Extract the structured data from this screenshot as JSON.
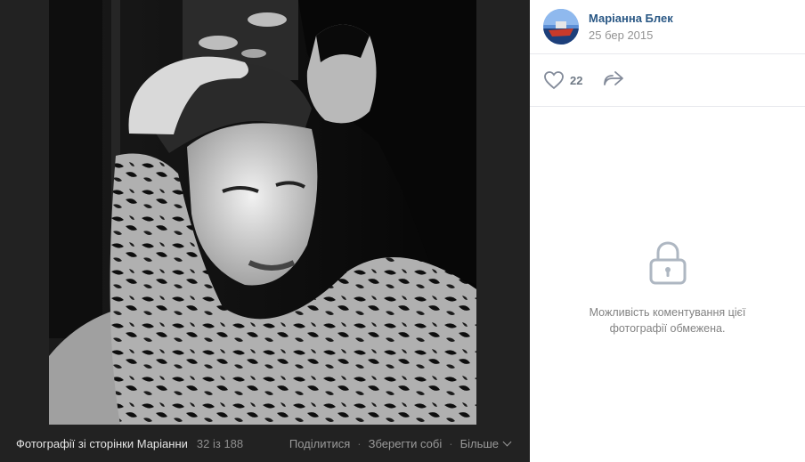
{
  "author": {
    "name": "Маріанна Блек",
    "date": "25 бер 2015"
  },
  "likes": {
    "count": "22"
  },
  "comments": {
    "restricted_line1": "Можливість коментування цієї",
    "restricted_line2": "фотографії обмежена."
  },
  "bottom_bar": {
    "album_title": "Фотографії зі сторінки Маріанни",
    "counter": "32 із 188",
    "share_label": "Поділитися",
    "save_label": "Зберегти собі",
    "more_label": "Більше",
    "separator": "·"
  },
  "colors": {
    "author_link": "#2a5885",
    "panel_bg": "#ffffff",
    "dark_bg": "#222222"
  },
  "icons": {
    "like": "heart-icon",
    "share": "share-arrow-icon",
    "lock": "lock-icon",
    "more": "chevron-down-icon"
  }
}
